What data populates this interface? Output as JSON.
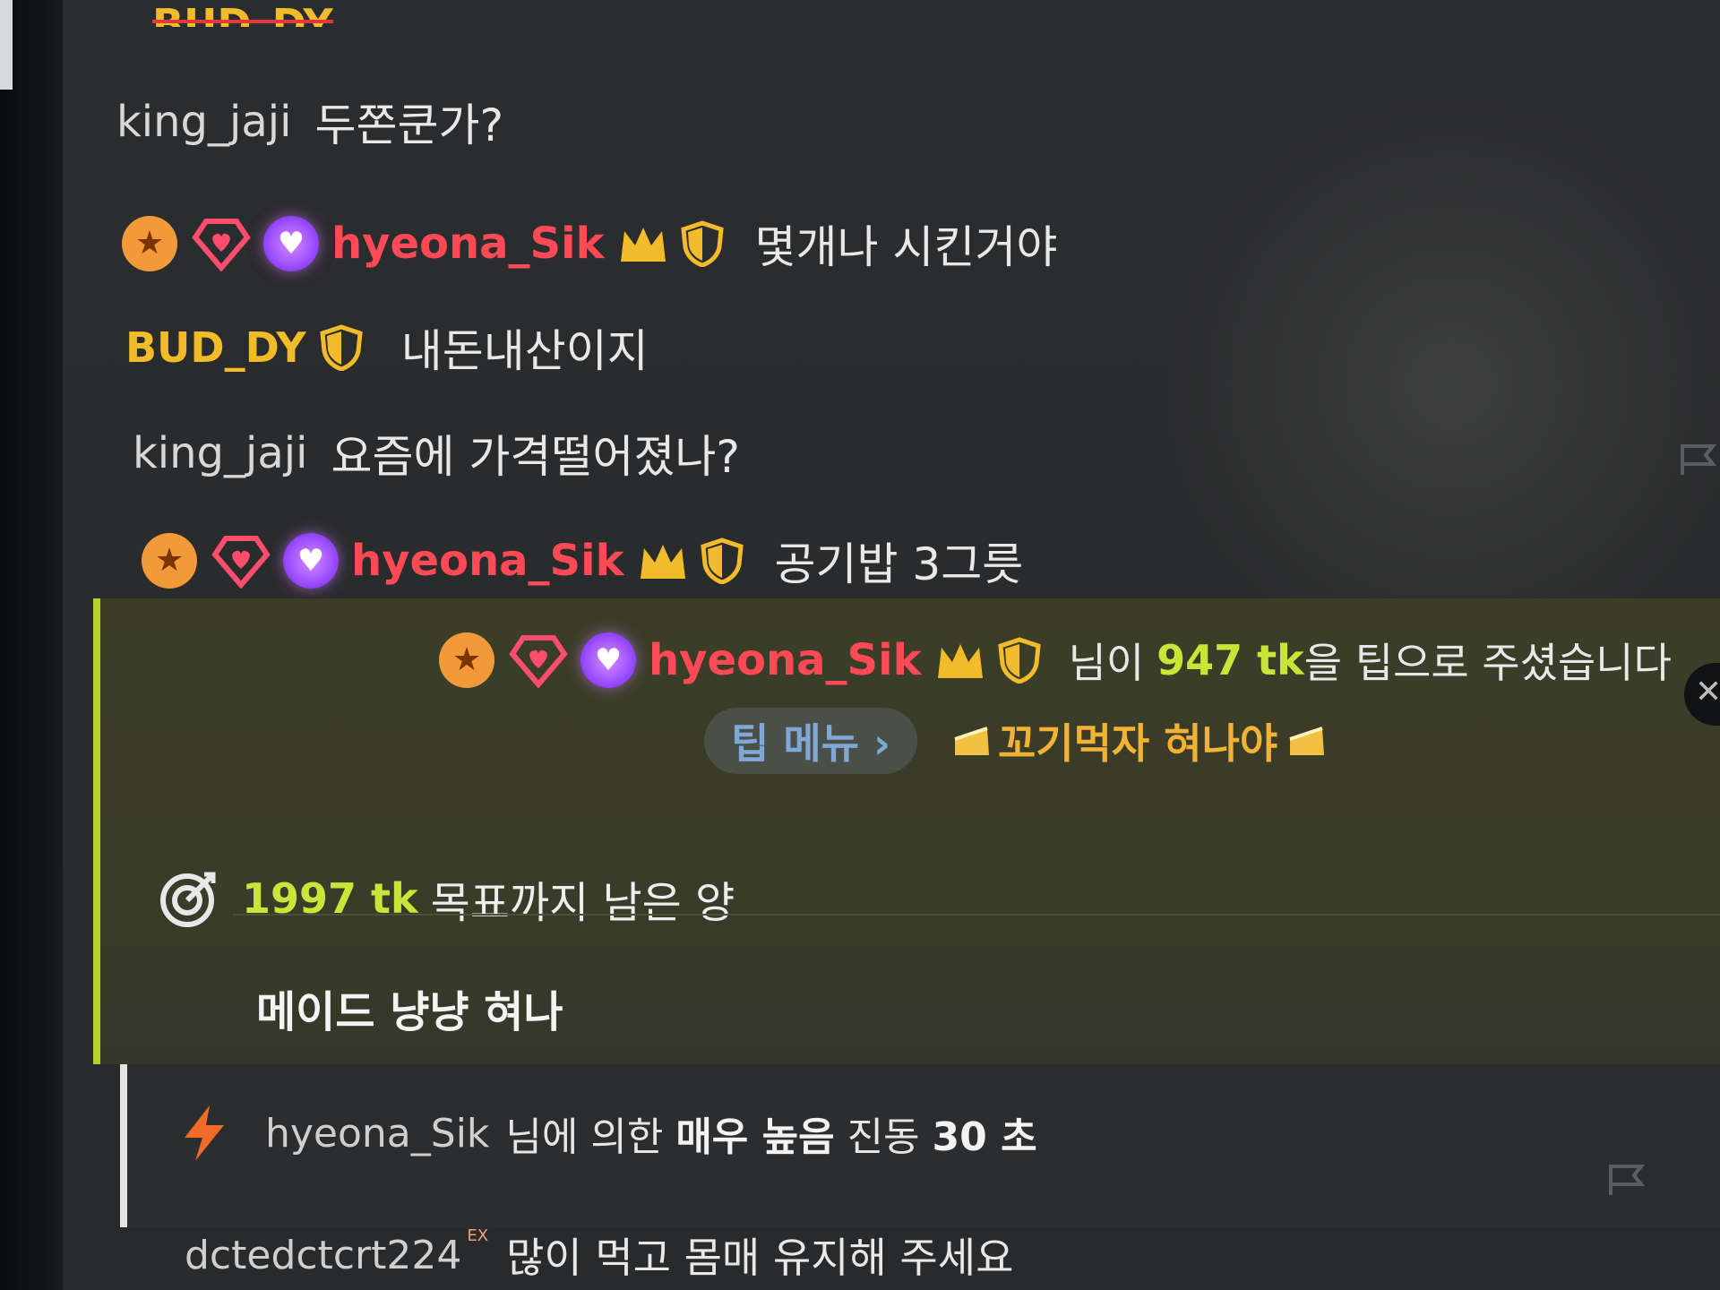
{
  "chat": {
    "cut_top_text": "BUD_DY",
    "messages": [
      {
        "user": "king_jaji",
        "text": "두쫀쿤가?"
      },
      {
        "user": "hyeona_Sik",
        "text": "몇개나 시킨거야"
      },
      {
        "user": "BUD_DY",
        "text": "내돈내산이지"
      },
      {
        "user": "king_jaji",
        "text": "요즘에 가격떨어졌나?"
      },
      {
        "user": "hyeona_Sik",
        "text": "공기밥 3그릇"
      }
    ],
    "tip": {
      "user": "hyeona_Sik",
      "prefix": "님이",
      "amount": "947 tk",
      "suffix": "을 팁으로 주셨습니다",
      "menu_button": "팁 메뉴 ›",
      "menu_item": "꼬기먹자 혀나야"
    },
    "goal": {
      "amount": "1997 tk",
      "text": "목표까지 남은 양",
      "title": "메이드 냥냥 혀나"
    },
    "vibration": {
      "user": "hyeona_Sik",
      "prefix": "님에 의한",
      "level": "매우 높음",
      "label": "진동",
      "duration": "30 초"
    },
    "last_message": {
      "user": "dctedctcrt224",
      "tag": "EX",
      "text": "많이 먹고 몸매 유지해 주세요"
    }
  },
  "colors": {
    "accent_green": "#c8e637",
    "username_red": "#ff4a55",
    "username_gold": "#f2bb2a",
    "tip_bar": "#b5d12a"
  },
  "icons": [
    "star-badge-icon",
    "diamond-heart-icon",
    "purple-heart-icon",
    "crown-icon",
    "shield-icon",
    "goal-target-icon",
    "lightning-icon",
    "flag-icon"
  ]
}
